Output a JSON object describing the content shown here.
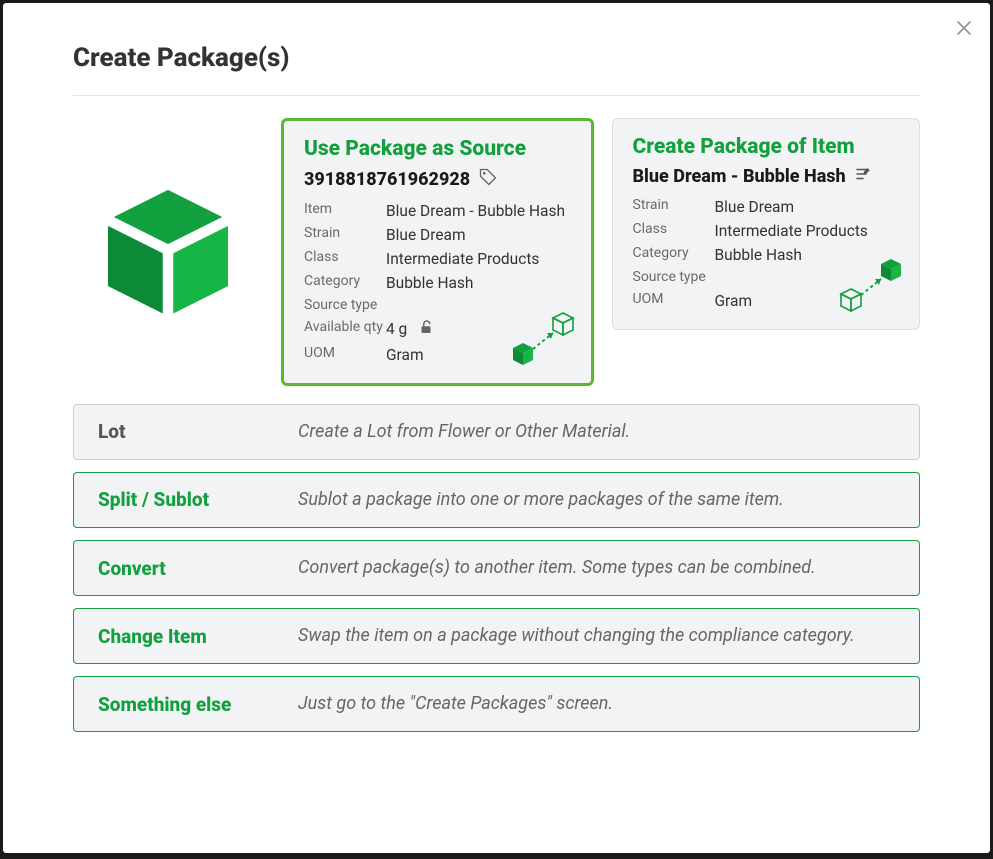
{
  "modal_title": "Create Package(s)",
  "source_card": {
    "title": "Use Package as Source",
    "package_id": "3918818761962928",
    "fields": {
      "item": {
        "label": "Item",
        "value": "Blue Dream - Bubble Hash"
      },
      "strain": {
        "label": "Strain",
        "value": "Blue Dream"
      },
      "class": {
        "label": "Class",
        "value": "Intermediate Products"
      },
      "category": {
        "label": "Category",
        "value": "Bubble Hash"
      },
      "source_type": {
        "label": "Source type",
        "value": ""
      },
      "available_qty": {
        "label": "Available qty",
        "value": "4 g"
      },
      "uom": {
        "label": "UOM",
        "value": "Gram"
      }
    }
  },
  "item_card": {
    "title": "Create Package of Item",
    "item_name": "Blue Dream - Bubble Hash",
    "fields": {
      "strain": {
        "label": "Strain",
        "value": "Blue Dream"
      },
      "class": {
        "label": "Class",
        "value": "Intermediate Products"
      },
      "category": {
        "label": "Category",
        "value": "Bubble Hash"
      },
      "source_type": {
        "label": "Source type",
        "value": ""
      },
      "uom": {
        "label": "UOM",
        "value": "Gram"
      }
    }
  },
  "options": {
    "lot": {
      "label": "Lot",
      "desc": "Create a Lot from Flower or Other Material."
    },
    "split": {
      "label": "Split / Sublot",
      "desc": "Sublot a package into one or more packages of the same item."
    },
    "convert": {
      "label": "Convert",
      "desc": "Convert package(s) to another item. Some types can be combined."
    },
    "change": {
      "label": "Change Item",
      "desc": "Swap the item on a package without changing the compliance category."
    },
    "else": {
      "label": "Something else",
      "desc": "Just go to the \"Create Packages\" screen."
    }
  }
}
